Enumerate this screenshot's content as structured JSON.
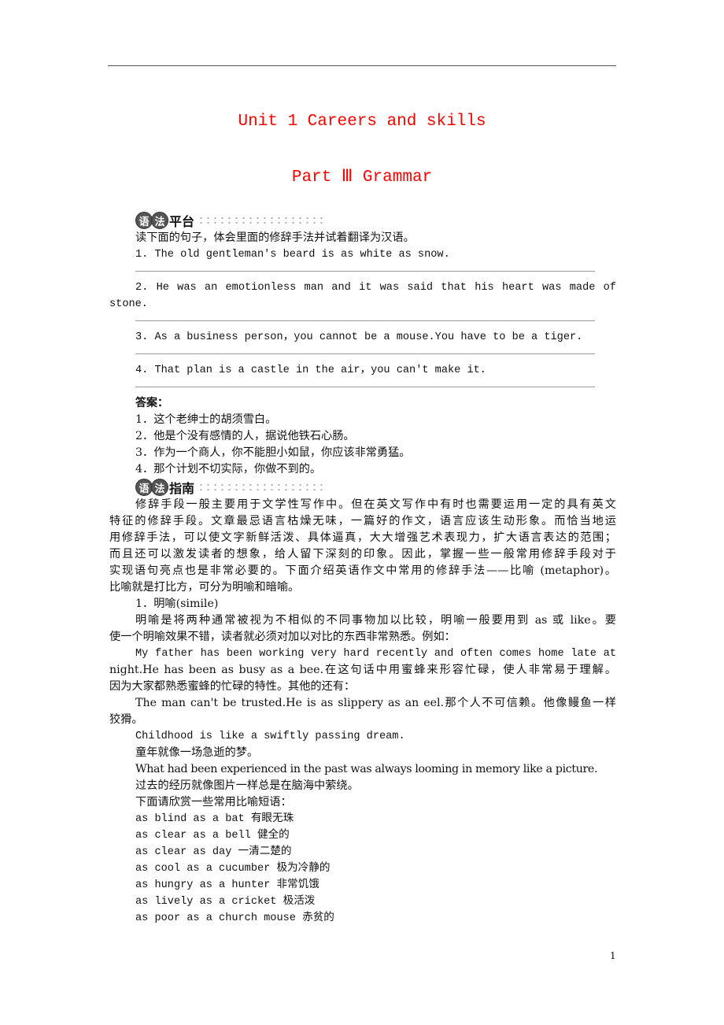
{
  "header": {
    "unit_title": "Unit 1  Careers and skills",
    "part_title": "Part Ⅲ  Grammar"
  },
  "platform": {
    "badge_1": "语",
    "badge_2": "法",
    "title": "平台",
    "instruction": "读下面的句子，体会里面的修辞手法并试着翻译为汉语。",
    "questions": [
      "1. The old gentleman's beard is as white as snow.",
      "2. He was an emotionless man and it was said that his heart was made of",
      "3. As a business person，you cannot be a mouse.You have to be a tiger.",
      "4. That plan is a castle in the air，you can't make it."
    ],
    "question_2_continuation": "stone."
  },
  "answers": {
    "label": "答案：",
    "items": [
      "1．这个老绅士的胡须雪白。",
      "2．他是个没有感情的人，据说他铁石心肠。",
      "3．作为一个商人，你不能胆小如鼠，你应该非常勇猛。",
      "4．那个计划不切实际，你做不到的。"
    ]
  },
  "guide": {
    "badge_1": "语",
    "badge_2": "法",
    "title": "指南",
    "intro_lines": [
      "修辞手段一般主要用于文学性写作中。但在英文写作中有时也需要运用一定的具有英文",
      "特征的修辞手段。文章最忌语言枯燥无味，一篇好的作文，语言应该生动形象。而恰当地运",
      "用修辞手法，可以使文字新鲜活泼、具体逼真，大大增强艺术表现力，扩大语言表达的范围；",
      "而且还可以激发读者的想象，给人留下深刻的印象。因此，掌握一些一般常用修辞手段对于",
      "实现语句亮点也是非常必要的。下面介绍英语作文中常用的修辞手法——比喻 (metaphor)。",
      "比喻就是打比方，可分为明喻和暗喻。"
    ],
    "simile_heading": "1．明喻(simile)",
    "simile_lines": [
      "明喻是将两种通常被视为不相似的不同事物加以比较，明喻一般要用到 as 或 like。要",
      "使一个明喻效果不错，读者就必须对加以对比的东西非常熟悉。例如：",
      "My father has been working very hard recently and often comes home late at",
      "night.He has been as busy as a bee.在这句话中用蜜蜂来形容忙碌，使人非常易于理解。",
      "因为大家都熟悉蜜蜂的忙碌的特性。其他的还有：",
      "The man can't be trusted.He is as slippery as an eel.那个人不可信赖。他像鳗鱼一样",
      "狡猾。",
      "Childhood is like a swiftly passing dream.",
      "童年就像一场急逝的梦。",
      "What had been experienced in the past was always looming in memory like a picture.",
      "过去的经历就像图片一样总是在脑海中萦绕。",
      "下面请欣赏一些常用比喻短语："
    ],
    "phrases": [
      "as blind as a bat 有眼无珠",
      "as clear as a bell 健全的",
      "as clear as day 一清二楚的",
      "as cool as a cucumber 极为冷静的",
      "as hungry as a hunter 非常饥饿",
      "as lively as a cricket 极活泼",
      "as poor as a church mouse 赤贫的"
    ]
  },
  "footer": {
    "page_number": "1"
  }
}
